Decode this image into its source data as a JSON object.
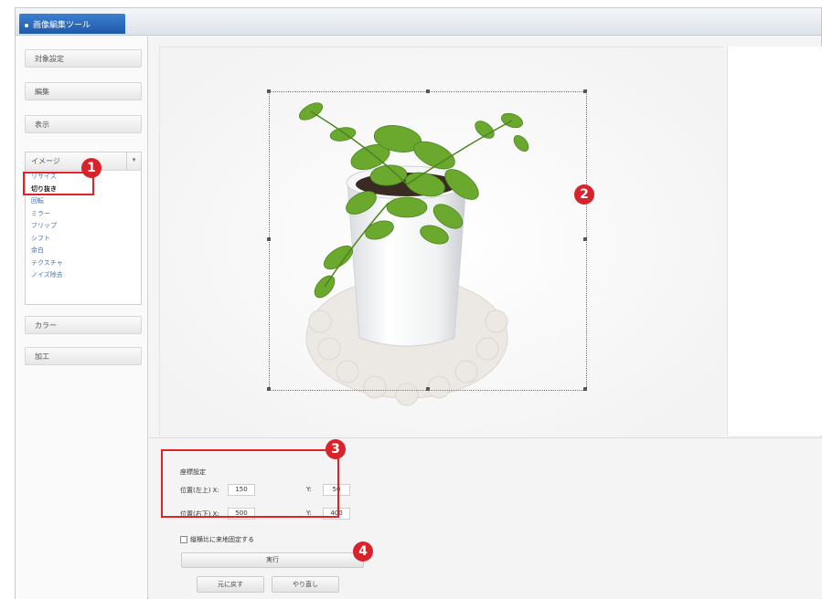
{
  "window": {
    "title": "画像編集ツール"
  },
  "sidebar": {
    "buttons": [
      "対象設定",
      "編集",
      "表示"
    ],
    "image_panel": {
      "header": "イメージ",
      "items": [
        "リサイズ",
        "切り抜き",
        "回転",
        "ミラー",
        "フリップ",
        "シフト",
        "余白",
        "テクスチャ",
        "ノイズ除去"
      ],
      "selected": "切り抜き"
    },
    "bottom_buttons": [
      "カラー",
      "加工"
    ]
  },
  "crop_settings": {
    "title": "座標設定",
    "rows": [
      {
        "label": "位置(左上) X:",
        "x": "150",
        "y_label": "Y:",
        "y": "50"
      },
      {
        "label": "位置(右下) X:",
        "x": "500",
        "y_label": "Y:",
        "y": "400"
      }
    ]
  },
  "checkbox": {
    "label": "縦横比に来地固定する",
    "checked": false
  },
  "run_button": "実行",
  "undo_button": "元に戻す",
  "redo_button": "やり直し",
  "markers": [
    "1",
    "2",
    "3",
    "4"
  ],
  "colors": {
    "accent": "#1f5aa8",
    "callout": "#d9232a"
  }
}
